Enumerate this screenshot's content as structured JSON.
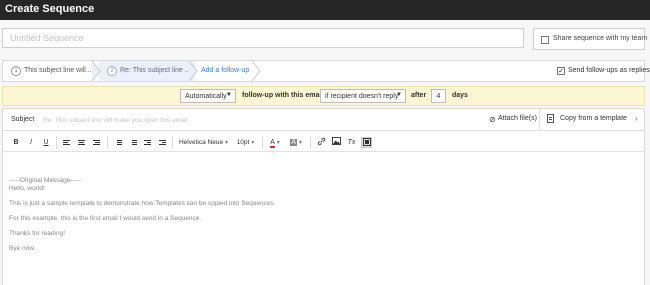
{
  "window": {
    "title": "Create Sequence"
  },
  "sequence_name": {
    "value": "",
    "placeholder": "Untitled Sequence"
  },
  "share": {
    "label": "Share sequence with my team",
    "checked": false
  },
  "steps": [
    {
      "number": "1",
      "label": "This subject line will..."
    },
    {
      "number": "2",
      "label": "Re: This subject line ..."
    }
  ],
  "add_followup_label": "Add a follow-up",
  "send_as_replies": {
    "label": "Send follow-ups as replies",
    "checked": true
  },
  "followup_rule": {
    "mode": "Automatically",
    "text_before": "follow-up with this email",
    "condition": "if recipient doesn't reply",
    "after_label": "after",
    "days_value": "4",
    "days_label": "days"
  },
  "subject": {
    "label": "Subject",
    "value": "",
    "placeholder": "Re: This subject line will make you open this email"
  },
  "attach_label": "Attach file(s)",
  "template_label": "Copy from a template",
  "toolbar": {
    "bold": "B",
    "italic": "I",
    "underline": "U",
    "font": "Helvetica Neue",
    "size": "10pt",
    "text_color": "A",
    "highlight": "A",
    "clear": "Tx"
  },
  "message_body": [
    "-----Original Message-----",
    "Hello, world!",
    "This is just a sample template to demonstrate how Templates can be copied into Sequences.",
    "For this example, this is the first email I would send in a Sequence.",
    "Thanks for reading!",
    "Bye now."
  ],
  "colors": {
    "topbar": "#262626",
    "followbar": "#fdf6d3",
    "active_step": "#eaf1fb",
    "link": "#3a7dc9"
  }
}
